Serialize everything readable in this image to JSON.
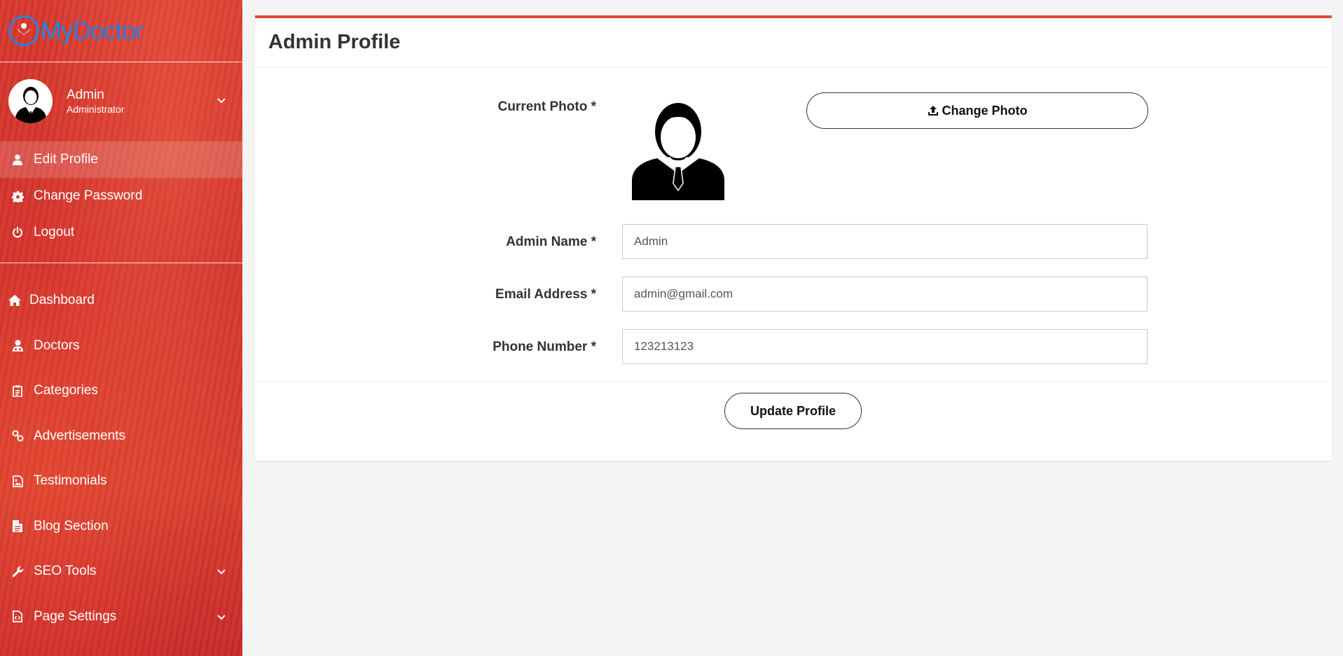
{
  "brand": {
    "part1": "My",
    "part2": "Doctor"
  },
  "user": {
    "name": "Admin",
    "role": "Administrator"
  },
  "account_menu": [
    {
      "label": "Edit Profile",
      "icon": "user-icon",
      "active": true
    },
    {
      "label": "Change Password",
      "icon": "gear-icon"
    },
    {
      "label": "Logout",
      "icon": "power-icon"
    }
  ],
  "main_menu": [
    {
      "label": "Dashboard",
      "icon": "home-icon"
    },
    {
      "label": "Doctors",
      "icon": "doctor-icon"
    },
    {
      "label": "Categories",
      "icon": "clipboard-icon"
    },
    {
      "label": "Advertisements",
      "icon": "link-icon"
    },
    {
      "label": "Testimonials",
      "icon": "image-icon"
    },
    {
      "label": "Blog Section",
      "icon": "document-icon"
    },
    {
      "label": "SEO Tools",
      "icon": "wrench-icon",
      "has_submenu": true
    },
    {
      "label": "Page Settings",
      "icon": "code-file-icon",
      "has_submenu": true
    }
  ],
  "page": {
    "title": "Admin Profile"
  },
  "form": {
    "photo_label": "Current Photo *",
    "change_photo_label": "Change Photo",
    "name_label": "Admin Name *",
    "name_value": "Admin",
    "email_label": "Email Address *",
    "email_value": "admin@gmail.com",
    "phone_label": "Phone Number *",
    "phone_value": "123213123",
    "submit_label": "Update Profile"
  },
  "colors": {
    "accent": "#dd4b39",
    "brand_blue": "#1e88e5",
    "sidebar": "#d4362c"
  }
}
